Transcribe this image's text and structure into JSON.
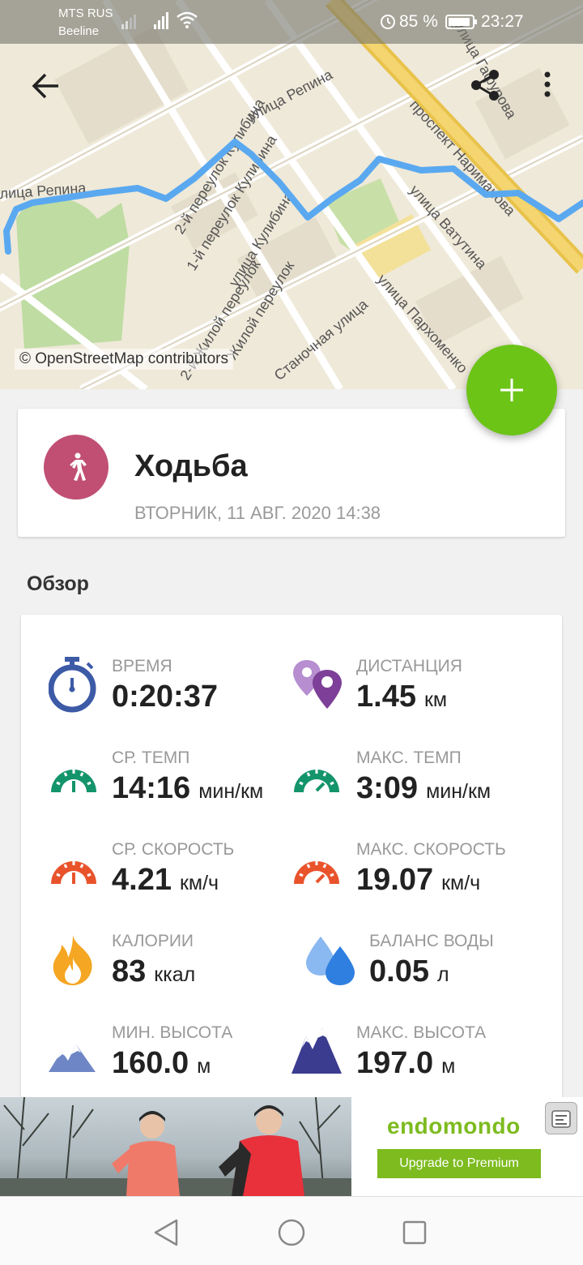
{
  "status_bar": {
    "carrier_1": "MTS RUS",
    "carrier_2": "Beeline",
    "battery_percent": "85 %",
    "time": "23:27"
  },
  "map": {
    "attribution": "© OpenStreetMap contributors",
    "street_labels": [
      "улица Репина",
      "лица Репина",
      "2-й переулок Кулибина",
      "1-й переулок Кулибина",
      "улица Кулибина",
      "проспект Нариманова",
      "улица Ватутина",
      "улица Пархоменко",
      "2-й Жилой переулок",
      "Жилой переулок",
      "Станочная улица",
      "улица Гафурова"
    ],
    "route_color": "#5aa9f0"
  },
  "toolbar": {
    "back_icon": "arrow-back-icon",
    "share_icon": "share-icon",
    "more_icon": "more-vert-icon"
  },
  "fab": {
    "icon": "plus-icon",
    "color": "#6cc417"
  },
  "workout": {
    "title": "Ходьба",
    "date": "ВТОРНИК, 11 АВГ. 2020 14:38",
    "avatar_color": "#c04f73",
    "avatar_icon": "walking-icon"
  },
  "overview": {
    "title": "Обзор",
    "stats": {
      "time": {
        "label": "ВРЕМЯ",
        "value": "0:20:37",
        "unit": "",
        "icon": "stopwatch-icon"
      },
      "distance": {
        "label": "ДИСТАНЦИЯ",
        "value": "1.45",
        "unit": "км",
        "icon": "map-pin-icon"
      },
      "avg_pace": {
        "label": "СР. ТЕМП",
        "value": "14:16",
        "unit": "мин/км",
        "icon": "gauge-green-icon"
      },
      "max_pace": {
        "label": "МАКС. ТЕМП",
        "value": "3:09",
        "unit": "мин/км",
        "icon": "gauge-green-icon"
      },
      "avg_speed": {
        "label": "СР. СКОРОСТЬ",
        "value": "4.21",
        "unit": "км/ч",
        "icon": "gauge-orange-icon"
      },
      "max_speed": {
        "label": "МАКС. СКОРОСТЬ",
        "value": "19.07",
        "unit": "км/ч",
        "icon": "gauge-orange-icon"
      },
      "calories": {
        "label": "КАЛОРИИ",
        "value": "83",
        "unit": "ккал",
        "icon": "flame-icon"
      },
      "water": {
        "label": "БАЛАНС ВОДЫ",
        "value": "0.05",
        "unit": "л",
        "icon": "water-drops-icon"
      },
      "min_altitude": {
        "label": "МИН. ВЫСОТА",
        "value": "160.0",
        "unit": "м",
        "icon": "mountain-light-icon"
      },
      "max_altitude": {
        "label": "МАКС. ВЫСОТА",
        "value": "197.0",
        "unit": "м",
        "icon": "mountain-dark-icon"
      }
    }
  },
  "ad": {
    "brand": "endomondo",
    "cta": "Upgrade to Premium",
    "brand_color": "#7dbb1f"
  },
  "nav_bar": {
    "back_icon": "nav-back-triangle-icon",
    "home_icon": "nav-home-circle-icon",
    "recents_icon": "nav-recents-square-icon"
  }
}
